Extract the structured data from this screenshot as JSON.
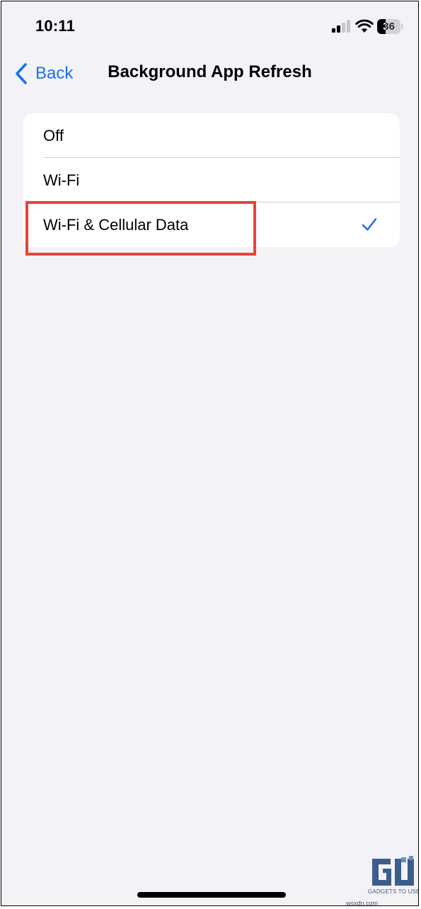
{
  "status_bar": {
    "time": "10:11",
    "battery_level": "36",
    "battery_fraction": 0.36,
    "signal_bars_active": 2,
    "signal_bars_total": 4
  },
  "nav": {
    "back_label": "Back",
    "title": "Background App Refresh"
  },
  "options": [
    {
      "label": "Off",
      "selected": false
    },
    {
      "label": "Wi-Fi",
      "selected": false
    },
    {
      "label": "Wi-Fi & Cellular Data",
      "selected": true
    }
  ],
  "watermark": {
    "logo_text": "GADGETS TO USE",
    "site": "wsxdn.com"
  },
  "colors": {
    "accent": "#1a73e8",
    "highlight": "#ea4335",
    "background": "#f2f2f7",
    "card": "#ffffff",
    "logo": "#3b5e8c"
  }
}
